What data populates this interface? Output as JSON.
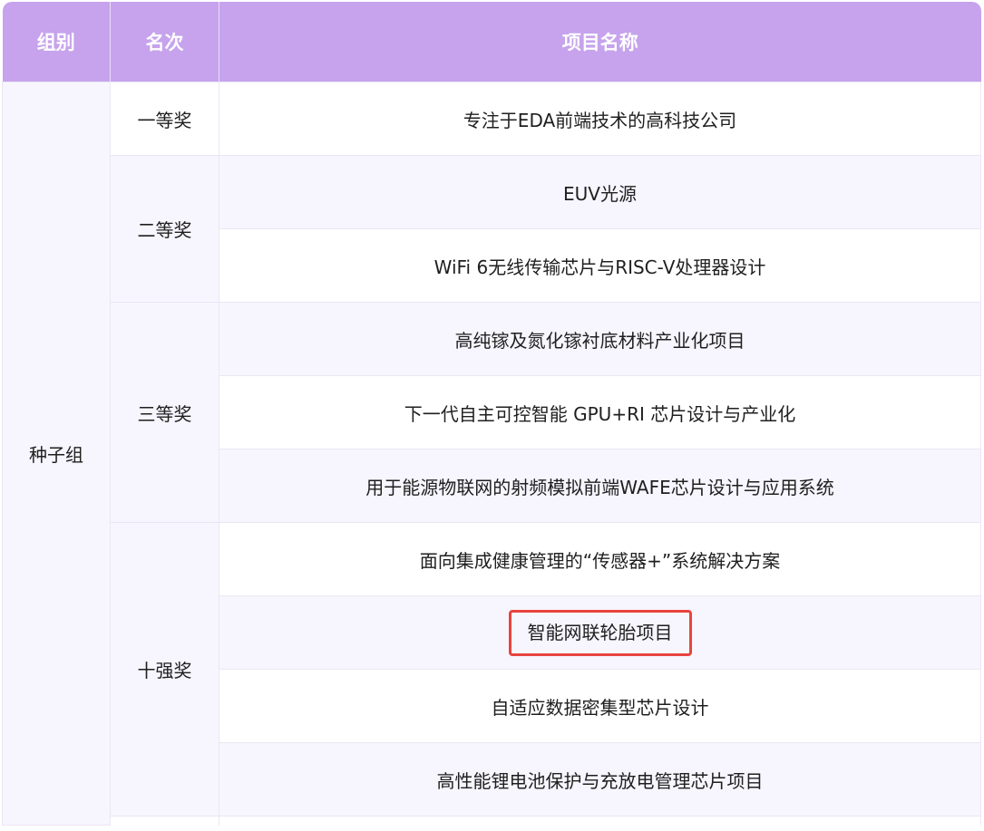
{
  "table": {
    "headers": {
      "group": "组别",
      "rank": "名次",
      "project": "项目名称"
    },
    "group_name": "种子组",
    "ranks": {
      "first": "一等奖",
      "second": "二等奖",
      "third": "三等奖",
      "top10": "十强奖"
    },
    "projects": [
      "专注于EDA前端技术的高科技公司",
      "EUV光源",
      "WiFi 6无线传输芯片与RISC-V处理器设计",
      "高纯镓及氮化镓衬底材料产业化项目",
      "下一代自主可控智能 GPU+RI 芯片设计与产业化",
      "用于能源物联网的射频模拟前端WAFE芯片设计与应用系统",
      "面向集成健康管理的“传感器+”系统解决方案",
      "智能网联轮胎项目",
      "自适应数据密集型芯片设计",
      "高性能锂电池保护与充放电管理芯片项目"
    ],
    "highlight_color": "#e8443e",
    "header_color": "#c6a3ec"
  }
}
